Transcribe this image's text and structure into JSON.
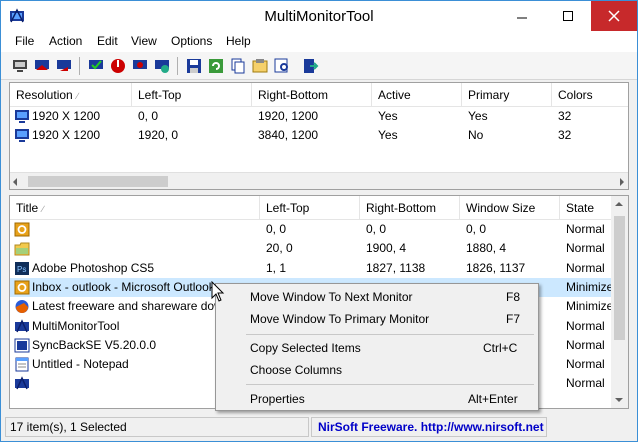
{
  "window": {
    "title": "MultiMonitorTool",
    "accent": "#3b8fd6",
    "close_color": "#c7292b"
  },
  "menu": [
    "File",
    "Action",
    "Edit",
    "View",
    "Options",
    "Help"
  ],
  "toolbar_icons": [
    "disable-monitor-icon",
    "enable-monitor-icon",
    "switch-monitor-icon",
    "set-primary-icon",
    "turn-off-monitor-icon",
    "monitor-settings-icon",
    "monitor-globe-icon",
    "save-icon",
    "refresh-icon",
    "copy-icon",
    "properties-icon",
    "find-icon",
    "exit-icon"
  ],
  "monitors": {
    "headers": [
      "Resolution",
      "Left-Top",
      "Right-Bottom",
      "Active",
      "Primary",
      "Colors"
    ],
    "rows": [
      [
        "1920 X 1200",
        "0, 0",
        "1920, 1200",
        "Yes",
        "Yes",
        "32"
      ],
      [
        "1920 X 1200",
        "1920, 0",
        "3840, 1200",
        "Yes",
        "No",
        "32"
      ]
    ]
  },
  "windows": {
    "headers": [
      "Title",
      "Left-Top",
      "Right-Bottom",
      "Window Size",
      "State"
    ],
    "rows": [
      {
        "icon": "outlook-icon",
        "title": "",
        "lt": "0, 0",
        "rb": "0, 0",
        "size": "0, 0",
        "state": "Normal"
      },
      {
        "icon": "folder-icon",
        "title": "",
        "lt": "20, 0",
        "rb": "1900, 4",
        "size": "1880, 4",
        "state": "Normal"
      },
      {
        "icon": "photoshop-icon",
        "title": "Adobe Photoshop CS5",
        "lt": "1, 1",
        "rb": "1827, 1138",
        "size": "1826, 1137",
        "state": "Normal"
      },
      {
        "icon": "outlook-icon",
        "title": "Inbox - outlook - Microsoft Outlook",
        "lt": "",
        "rb": "",
        "size": "",
        "state": "Minimize"
      },
      {
        "icon": "firefox-icon",
        "title": "Latest freeware and shareware downloads",
        "lt": "",
        "rb": "",
        "size": "",
        "state": "Minimize"
      },
      {
        "icon": "multimonitor-icon",
        "title": "MultiMonitorTool",
        "lt": "",
        "rb": "",
        "size": "",
        "state": "Normal"
      },
      {
        "icon": "syncback-icon",
        "title": "SyncBackSE V5.20.0.0",
        "lt": "",
        "rb": "",
        "size": "",
        "state": "Normal"
      },
      {
        "icon": "notepad-icon",
        "title": "Untitled - Notepad",
        "lt": "",
        "rb": "",
        "size": "",
        "state": "Normal"
      },
      {
        "icon": "multimonitor-icon",
        "title": "",
        "lt": "",
        "rb": "",
        "size": "",
        "state": "Normal"
      }
    ],
    "selected_index": 3
  },
  "context_menu": {
    "items": [
      {
        "label": "Move Window To Next Monitor",
        "key": "F8"
      },
      {
        "label": "Move Window To Primary Monitor",
        "key": "F7"
      },
      {
        "label": "Copy Selected Items",
        "key": "Ctrl+C"
      },
      {
        "label": "Choose Columns",
        "key": ""
      },
      {
        "label": "Properties",
        "key": "Alt+Enter"
      }
    ]
  },
  "status": {
    "count": "17 item(s), 1 Selected",
    "credit": "NirSoft Freeware.  http://www.nirsoft.net"
  }
}
